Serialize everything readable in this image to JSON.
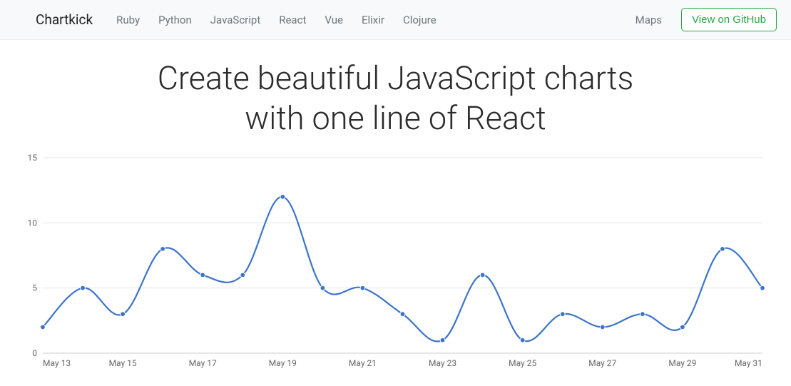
{
  "nav": {
    "brand": "Chartkick",
    "links": [
      "Ruby",
      "Python",
      "JavaScript",
      "React",
      "Vue",
      "Elixir",
      "Clojure"
    ],
    "right_link": "Maps",
    "github_btn": "View on GitHub"
  },
  "hero": {
    "title_l1": "Create beautiful JavaScript charts",
    "title_l2": "with one line of React"
  },
  "chart_data": {
    "type": "line",
    "xlabel": "",
    "ylabel": "",
    "ylim": [
      0,
      15
    ],
    "yticks": [
      0,
      5,
      10,
      15
    ],
    "xticks": [
      "May 13",
      "May 15",
      "May 17",
      "May 19",
      "May 21",
      "May 23",
      "May 25",
      "May 27",
      "May 29",
      "May 31"
    ],
    "categories": [
      "May 13",
      "May 14",
      "May 15",
      "May 16",
      "May 17",
      "May 18",
      "May 19",
      "May 20",
      "May 21",
      "May 22",
      "May 23",
      "May 24",
      "May 25",
      "May 26",
      "May 27",
      "May 28",
      "May 29",
      "May 30",
      "May 31"
    ],
    "values": [
      2,
      5,
      3,
      8,
      6,
      6,
      12,
      5,
      5,
      3,
      1,
      6,
      1,
      3,
      2,
      3,
      2,
      8,
      5
    ],
    "color": "#3b74c9"
  }
}
